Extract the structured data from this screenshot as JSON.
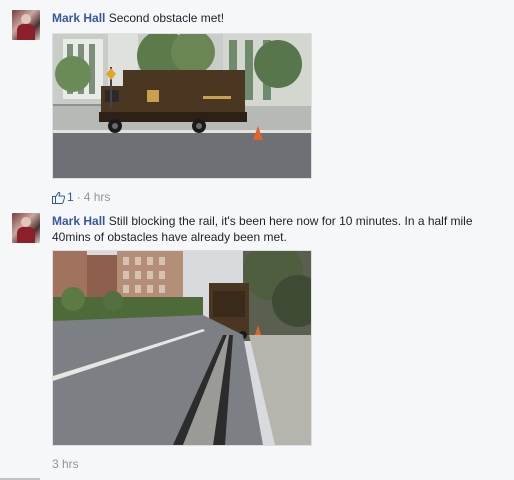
{
  "comments": [
    {
      "author": "Mark Hall",
      "text": "Second obstacle met!",
      "likes": "1",
      "separator": "·",
      "time": "4 hrs"
    },
    {
      "author": "Mark Hall",
      "text": "Still blocking the rail, it's been here now for 10 minutes. In a half mile 40mins of obstacles have already been met.",
      "time": "3 hrs"
    }
  ],
  "colors": {
    "author_link": "#365899",
    "meta_text": "#90949c",
    "background": "#f6f7f9"
  },
  "icons": {
    "like": "thumbs-up-outline-icon"
  }
}
